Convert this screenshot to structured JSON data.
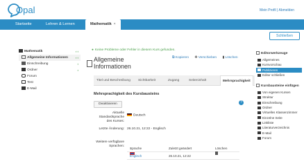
{
  "header": {
    "logo_text": "Opal",
    "profile": "Mein Profil",
    "separator": "|",
    "logout": "Abmelden"
  },
  "nav": {
    "start": "Startseite",
    "lehren": "Lehren & Lernen",
    "tab": "Mathematik",
    "tab_close": "×"
  },
  "close_button": "Schließen",
  "sidebar": {
    "root": "Mathematik",
    "items": [
      {
        "label": "Allgemeine Informationen",
        "icon": "document-icon"
      },
      {
        "label": "Einschreibung",
        "icon": "enrollment-icon"
      },
      {
        "label": "Ordner",
        "icon": "folder-icon"
      },
      {
        "label": "Forum",
        "icon": "forum-icon"
      },
      {
        "label": "Test",
        "icon": "test-icon"
      },
      {
        "label": "E-Mail",
        "icon": "mail-icon"
      }
    ]
  },
  "main": {
    "status": "Keine Probleme oder Fehler in diesem Kurs gefunden.",
    "title": "Allgemeine Informationen",
    "actions": {
      "copy": "Kopieren",
      "move": "Verschieben",
      "delete": "Löschen"
    },
    "tabs": [
      "Titel und Beschreibung",
      "Sichtbarkeit",
      "Zugang",
      "Seiteninhalt",
      "Mehrsprachigkeit"
    ],
    "section_title": "Mehrsprachigkeit des Kursbausteins",
    "deactivate": "Deaktivieren",
    "std_label": "Aktuelle Standardsprache des Kurses:",
    "std_value": "Deutsch",
    "change_label": "Letzte Änderung:",
    "change_value": "26.10.21, 12:22 - Englisch",
    "more_label": "Weitere verfügbare Sprachen:",
    "table": {
      "headers": [
        "Sprache",
        "Zuletzt geändert",
        "Löschen"
      ],
      "rows": [
        {
          "lang": "Englisch",
          "date": "26.10.21, 12:22"
        }
      ]
    }
  },
  "rightpanel": {
    "editor_title": "Editorwerkzeuge",
    "editor_items": [
      "Allgemeines",
      "Kursvorschau",
      "Publizieren",
      "Editor schließen"
    ],
    "editor_active": 2,
    "insert_title": "Kursbausteine einfügen",
    "insert_items": [
      "Von eigenen Kursen",
      "Struktur",
      "Einschreibung",
      "Ordner",
      "Virtuelles Klassenzimmer",
      "Einzelne Seite",
      "Linkliste",
      "Literaturverzeichnis",
      "E-Mail",
      "Forum"
    ]
  },
  "colors": {
    "accent": "#2b8cc4",
    "success": "#4aa04a"
  }
}
